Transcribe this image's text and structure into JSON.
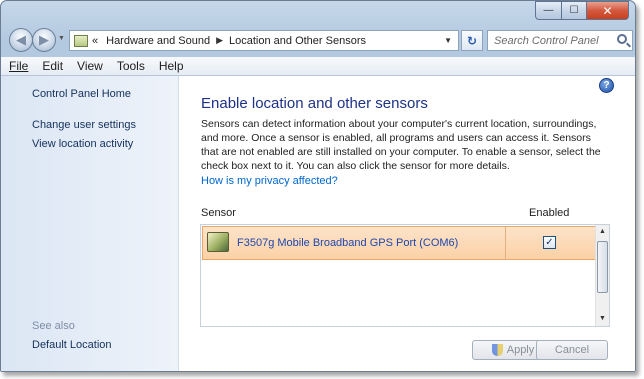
{
  "window": {
    "minimize_glyph": "—",
    "maximize_glyph": "☐",
    "close_glyph": "✕"
  },
  "address": {
    "crumbs_prefix": "«",
    "crumb1": "Hardware and Sound",
    "crumb2": "Location and Other Sensors",
    "search_placeholder": "Search Control Panel"
  },
  "menu": {
    "file": "File",
    "edit": "Edit",
    "view": "View",
    "tools": "Tools",
    "help": "Help"
  },
  "left": {
    "home": "Control Panel Home",
    "change_user_settings": "Change user settings",
    "view_location_activity": "View location activity",
    "see_also": "See also",
    "default_location": "Default Location"
  },
  "main": {
    "title": "Enable location and other sensors",
    "description": "Sensors can detect information about your computer's current location, surroundings, and more. Once a sensor is enabled, all programs and users can access it. Sensors that are not enabled are still installed on your computer. To enable a sensor, select the check box next to it. You can also click the sensor for more details.",
    "privacy_link": "How is my privacy affected?",
    "col_sensor": "Sensor",
    "col_enabled": "Enabled",
    "sensors": [
      {
        "name": "F3507g Mobile Broadband GPS Port (COM6)",
        "enabled": true
      }
    ]
  },
  "buttons": {
    "apply": "Apply",
    "cancel": "Cancel"
  },
  "icons": {
    "help": "?",
    "back": "◀",
    "forward": "▶",
    "refresh": "↻",
    "checkmark": "✓"
  }
}
